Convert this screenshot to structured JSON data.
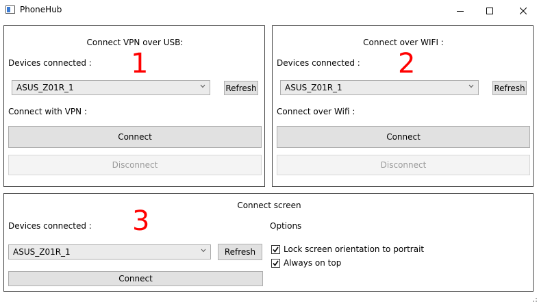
{
  "window": {
    "title": "PhoneHub",
    "icon": "app-window-icon",
    "controls": [
      "minimize-icon",
      "maximize-icon",
      "close-icon"
    ]
  },
  "vpn_panel": {
    "heading": "Connect VPN over USB:",
    "number": "1",
    "devices_label": "Devices connected :",
    "device_selected": "ASUS_Z01R_1",
    "refresh_label": "Refresh",
    "connect_with_label": "Connect with VPN :",
    "connect_label": "Connect",
    "disconnect_label": "Disconnect"
  },
  "wifi_panel": {
    "heading": "Connect over WIFI :",
    "number": "2",
    "devices_label": "Devices connected :",
    "device_selected": "ASUS_Z01R_1",
    "refresh_label": "Refresh",
    "connect_with_label": "Connect over Wifi :",
    "connect_label": "Connect",
    "disconnect_label": "Disconnect"
  },
  "screen_panel": {
    "heading": "Connect screen",
    "number": "3",
    "devices_label": "Devices connected :",
    "device_selected": "ASUS_Z01R_1",
    "refresh_label": "Refresh",
    "connect_label": "Connect",
    "options_label": "Options",
    "options": [
      {
        "label": "Lock screen orientation to portrait",
        "checked": true
      },
      {
        "label": "Always on top",
        "checked": true
      }
    ]
  },
  "colors": {
    "annotation": "#ff0000",
    "button_bg": "#e1e1e1",
    "disabled_text": "#9a9a9a"
  }
}
